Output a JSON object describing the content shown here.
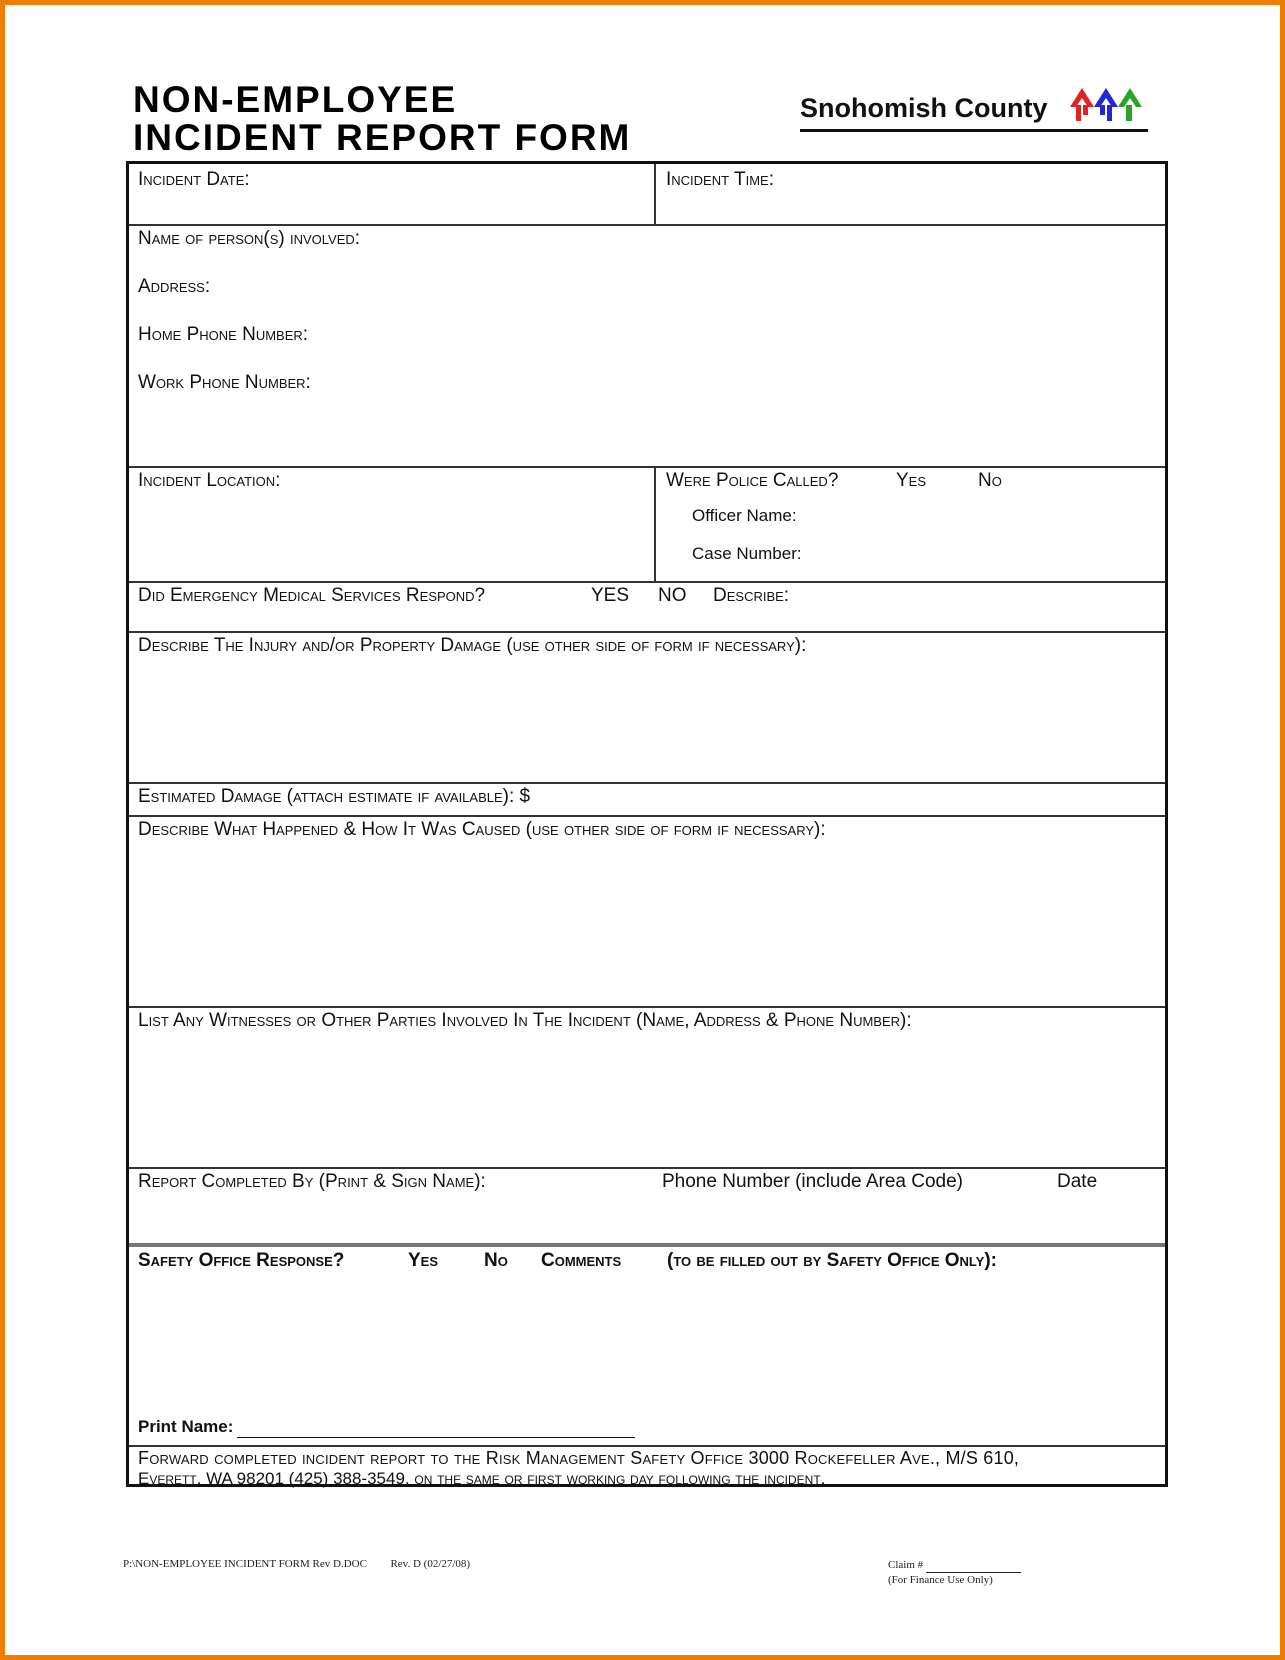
{
  "header": {
    "title_line1": "NON-EMPLOYEE",
    "title_line2": "INCIDENT REPORT FORM",
    "logo_text": "Snohomish County",
    "logo_icon": "three-arrow-houses-logo-icon",
    "logo_colors": [
      "#e32222",
      "#2424d8",
      "#2aa22a"
    ]
  },
  "form": {
    "incident_date": "Incident Date:",
    "incident_time": "Incident Time:",
    "name_involved": "Name of person(s) involved:",
    "address": "Address:",
    "home_phone": "Home Phone Number:",
    "work_phone": "Work Phone Number:",
    "incident_location": "Incident Location:",
    "police_called": "Were Police Called?",
    "police_yes": "Yes",
    "police_no": "No",
    "officer_name": "Officer Name:",
    "case_number": "Case Number:",
    "ems_question": "Did Emergency Medical Services Respond?",
    "ems_yes": "YES",
    "ems_no": "NO",
    "ems_describe": "Describe:",
    "injury_damage": "Describe The Injury and/or Property Damage (use other side of form if necessary):",
    "estimated_damage": "Estimated Damage (attach estimate if available): $",
    "what_happened": "Describe  What Happened & How  It Was Caused (use other side of form if necessary):",
    "witnesses": "List Any Witnesses or Other Parties Involved In The Incident (Name, Address & Phone Number):",
    "completed_by": "Report Completed By (Print & Sign Name):",
    "phone_area_code": "Phone Number (include Area Code)",
    "date": "Date",
    "safety_response": "Safety Office Response?",
    "safety_yes": "Yes",
    "safety_no": "No",
    "comments": "Comments",
    "safety_only": "(to be filled out by Safety Office Only):",
    "print_name": "Print Name:",
    "forward_line1": "Forward completed incident report to the Risk Management Safety Office 3000 Rockefeller Ave., M/S 610,",
    "forward_line2": "Everett, WA  98201 (425) 388-3549, on the same or first working day following the incident."
  },
  "footer": {
    "file_path": "P:\\NON-EMPLOYEE INCIDENT FORM Rev D.DOC",
    "revision": "Rev. D (02/27/08)",
    "claim_label": "Claim #",
    "finance_note": "(For Finance Use Only)"
  },
  "page_border_color": "#f07d00"
}
